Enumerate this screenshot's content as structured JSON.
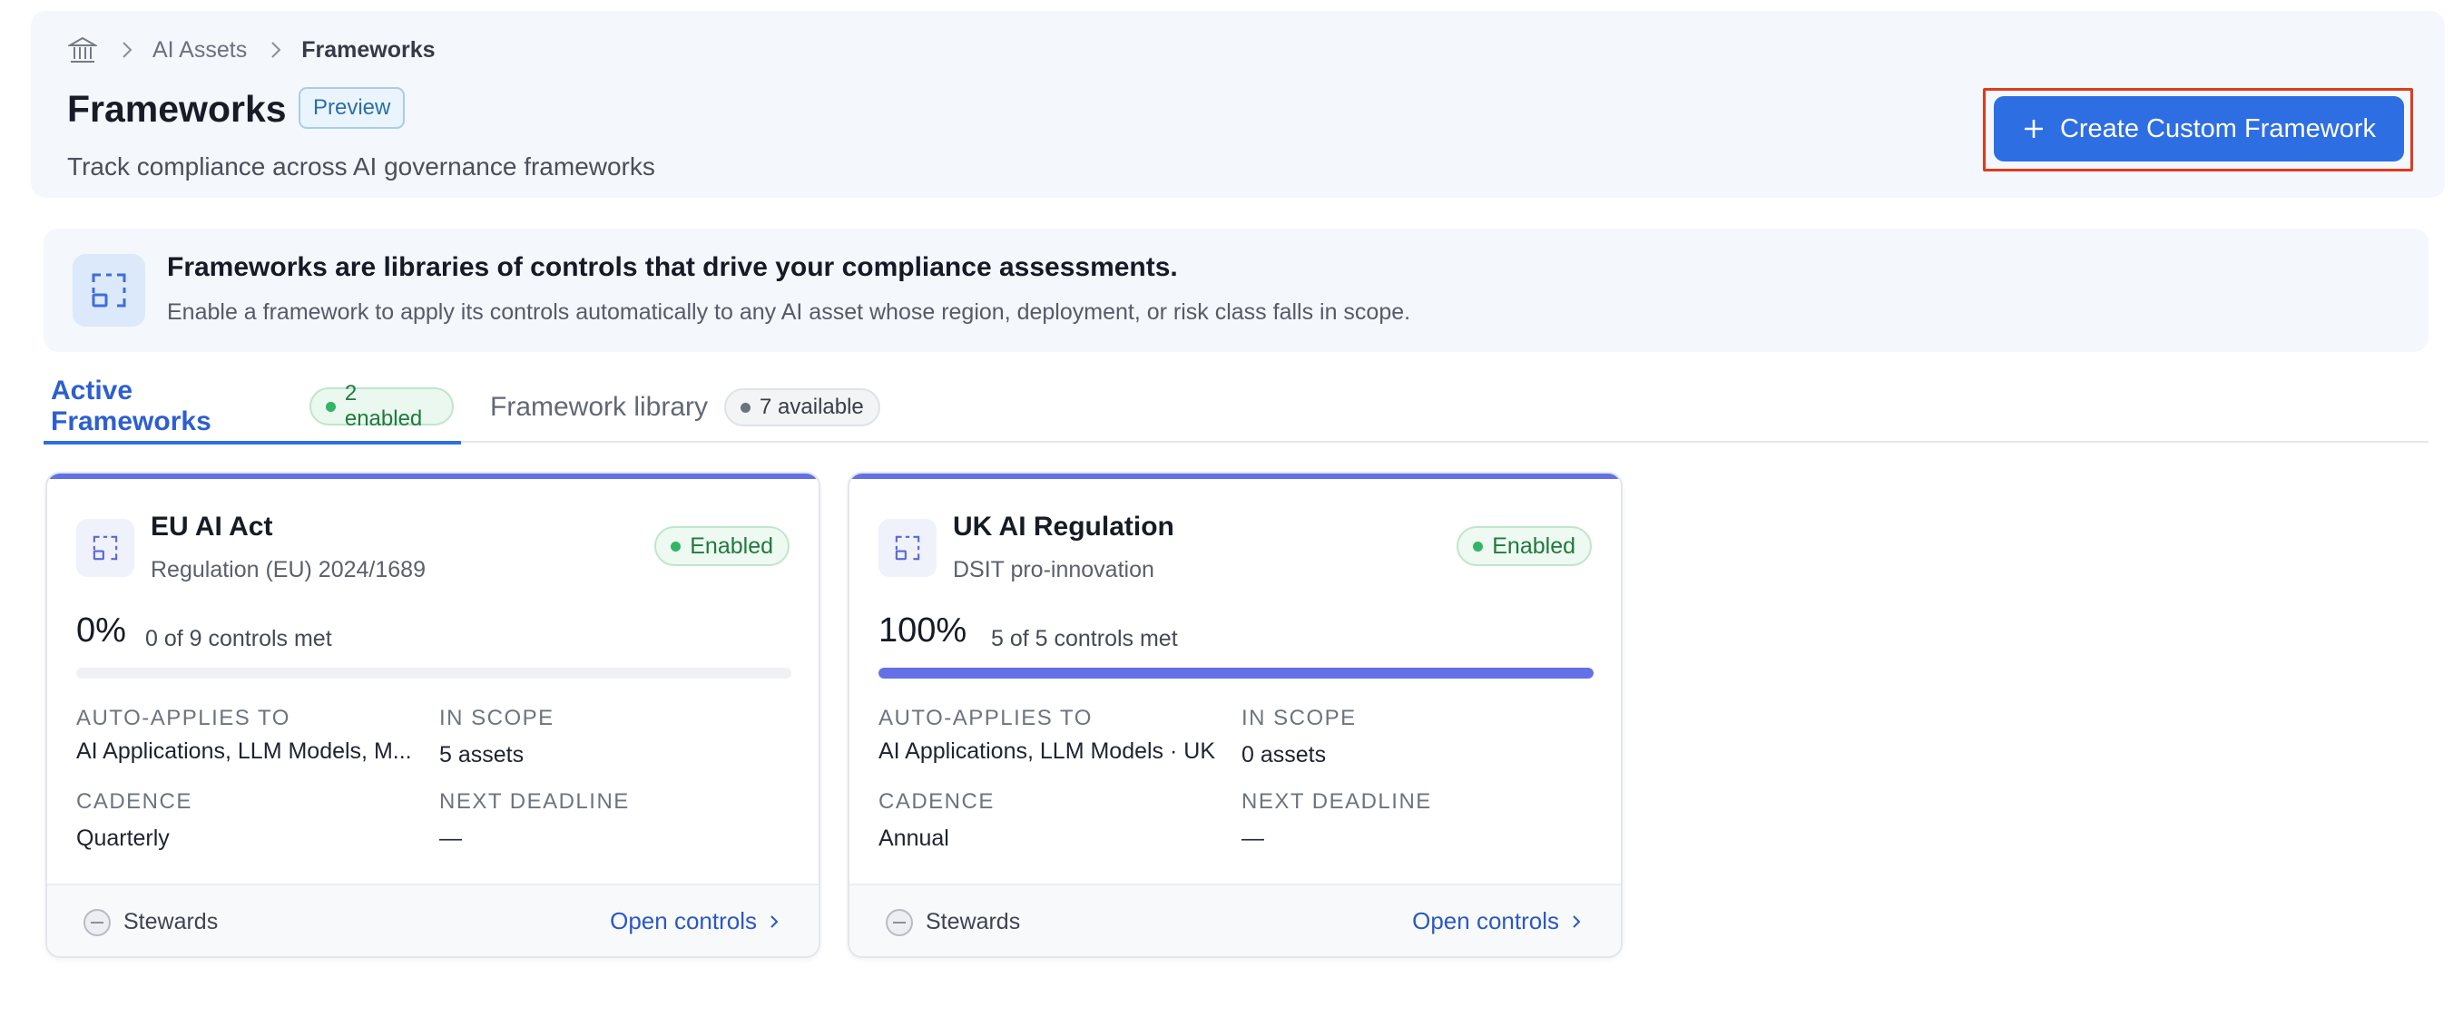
{
  "breadcrumb": {
    "items": [
      "AI Assets",
      "Frameworks"
    ]
  },
  "header": {
    "title": "Frameworks",
    "badge": "Preview",
    "subtitle": "Track compliance across AI governance frameworks",
    "create_button": "Create Custom Framework"
  },
  "banner": {
    "title": "Frameworks are libraries of controls that drive your compliance assessments.",
    "text": "Enable a framework to apply its controls automatically to any AI asset whose region, deployment, or risk class falls in scope."
  },
  "tabs": [
    {
      "label": "Active Frameworks",
      "badge": "2 enabled",
      "active": true
    },
    {
      "label": "Framework library",
      "badge": "7 available",
      "active": false
    }
  ],
  "labels": {
    "auto_applies": "AUTO-APPLIES TO",
    "in_scope": "IN SCOPE",
    "cadence": "CADENCE",
    "next_deadline": "NEXT DEADLINE",
    "stewards": "Stewards",
    "open_controls": "Open controls"
  },
  "cards": [
    {
      "name": "EU AI Act",
      "subtitle": "Regulation (EU) 2024/1689",
      "status": "Enabled",
      "percent": "0%",
      "controls_met": "0 of 9 controls met",
      "progress": 0,
      "auto_applies": "AI Applications, LLM Models, M...",
      "in_scope": "5 assets",
      "cadence": "Quarterly",
      "next_deadline": "—"
    },
    {
      "name": "UK AI Regulation",
      "subtitle": "DSIT pro-innovation",
      "status": "Enabled",
      "percent": "100%",
      "controls_met": "5 of 5 controls met",
      "progress": 1,
      "auto_applies": "AI Applications, LLM Models · UK",
      "in_scope": "0 assets",
      "cadence": "Annual",
      "next_deadline": "—"
    }
  ],
  "colors": {
    "accent": "#2e6ee3",
    "progress": "#6470e6",
    "enabled_green": "#1f7a3f",
    "highlight_outline": "#e03a1c"
  }
}
